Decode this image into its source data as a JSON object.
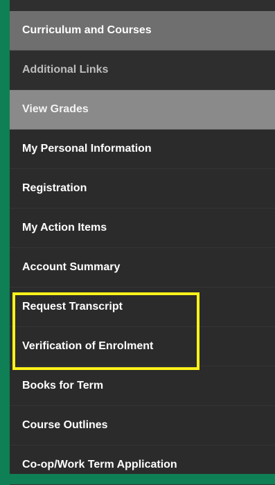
{
  "menu": {
    "items": [
      {
        "label": "Curriculum and Courses"
      },
      {
        "label": "Additional Links"
      },
      {
        "label": "View Grades"
      },
      {
        "label": "My Personal Information"
      },
      {
        "label": "Registration"
      },
      {
        "label": "My Action Items"
      },
      {
        "label": "Account Summary"
      },
      {
        "label": "Request Transcript"
      },
      {
        "label": "Verification of Enrolment"
      },
      {
        "label": "Books for Term"
      },
      {
        "label": "Course Outlines"
      },
      {
        "label": "Co-op/Work Term Application"
      }
    ]
  },
  "colors": {
    "background": "#0f7f55",
    "panel": "#2b2b2b",
    "active_item": "#6f6f6f",
    "grades_item": "#8a8a8a",
    "highlight": "#fff21a"
  }
}
